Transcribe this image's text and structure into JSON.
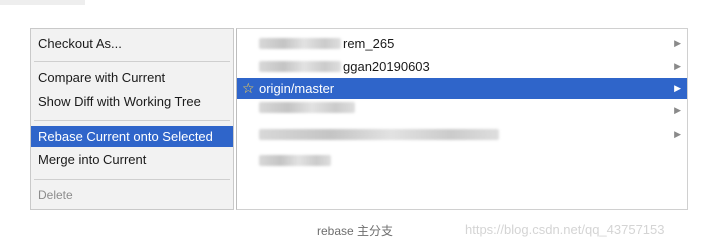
{
  "context_menu": {
    "items": [
      {
        "label": "Checkout As..."
      },
      {
        "label": "Compare with Current"
      },
      {
        "label": "Show Diff with Working Tree"
      },
      {
        "label": "Rebase Current onto Selected"
      },
      {
        "label": "Merge into Current"
      },
      {
        "label": "Delete"
      }
    ],
    "selected_index": 3,
    "selected_color": "#2f65ca"
  },
  "branches": {
    "rows": [
      {
        "visible_text": "rem_265",
        "obscured": true,
        "arrow": "chevron-right-icon"
      },
      {
        "visible_text": "ggan20190603",
        "obscured": true,
        "arrow": "chevron-right-icon"
      },
      {
        "visible_text": "origin/master",
        "starred": true,
        "selected": true,
        "arrow": "chevron-right-icon"
      },
      {
        "visible_text": "",
        "obscured": true,
        "arrow": "chevron-right-icon"
      },
      {
        "visible_text": "",
        "obscured": true,
        "arrow": "chevron-right-icon"
      },
      {
        "visible_text": "",
        "obscured": true
      }
    ],
    "star_color": "#ffd24a",
    "icons": {
      "star": "☆",
      "arrow": "▶"
    }
  },
  "caption": "rebase 主分支",
  "watermark": "https://blog.csdn.net/qq_43757153"
}
